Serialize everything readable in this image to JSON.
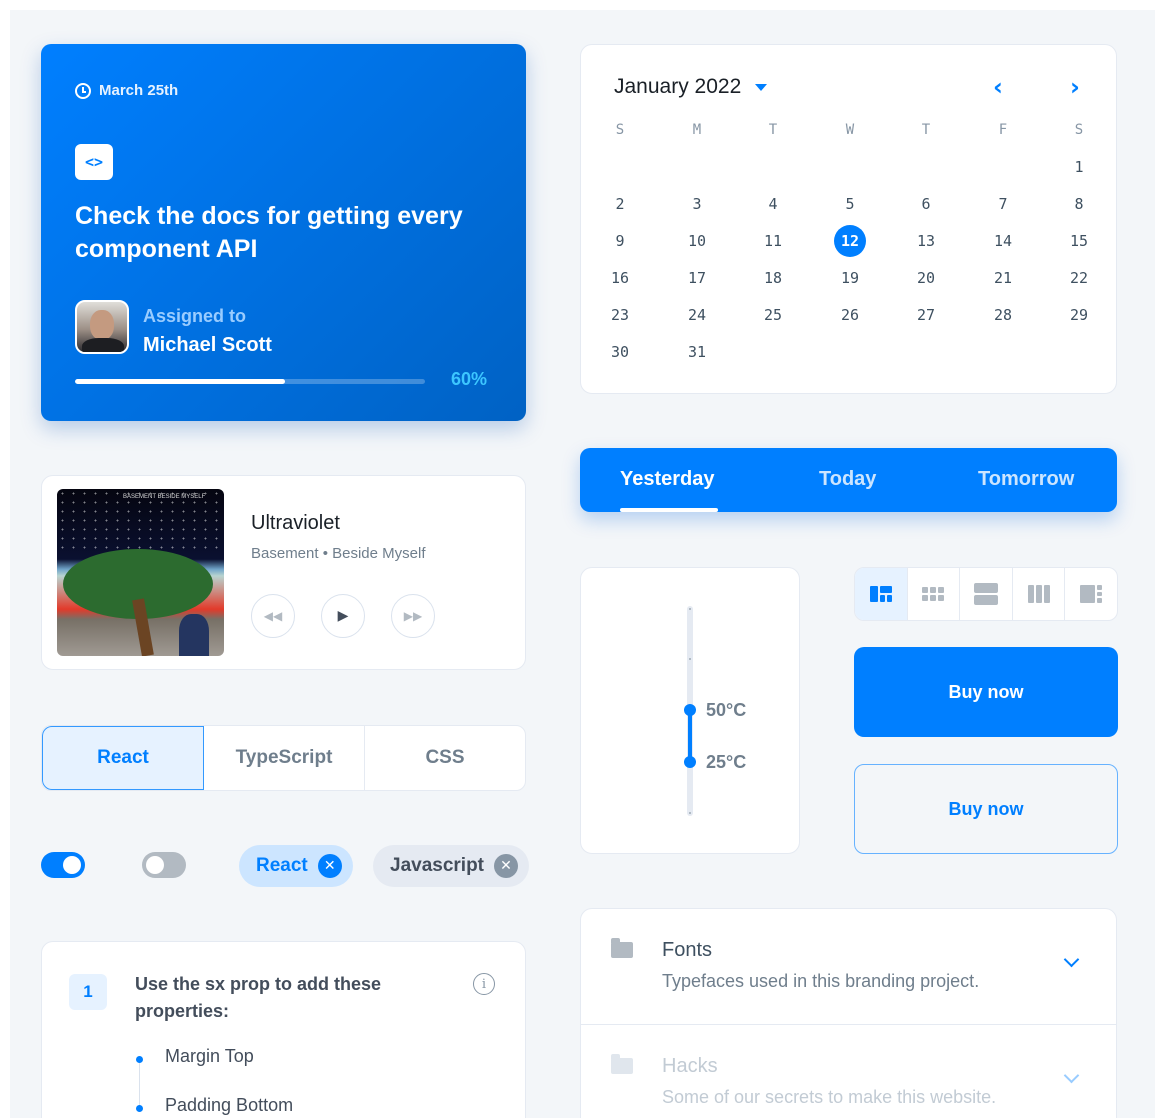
{
  "task_card": {
    "date": "March 25th",
    "code_icon": "code-icon",
    "title": "Check the docs for getting every component API",
    "assigned_label": "Assigned to",
    "assignee": "Michael Scott",
    "progress": 0.6,
    "progress_label": "60%"
  },
  "calendar": {
    "month_label": "January 2022",
    "weekdays": [
      "S",
      "M",
      "T",
      "W",
      "T",
      "F",
      "S"
    ],
    "first_weekday_index": 6,
    "days_in_month": 31,
    "selected_day": 12,
    "prev_icon": "chevron-left-icon",
    "next_icon": "chevron-right-icon"
  },
  "day_tabs": {
    "items": [
      "Yesterday",
      "Today",
      "Tomorrow"
    ],
    "active": 0
  },
  "player": {
    "album_art_text": "BASEMENT BESIDE MYSELF",
    "song": "Ultraviolet",
    "artist_line": "Basement • Beside Myself",
    "controls": [
      "rewind-icon",
      "play-icon",
      "fast-forward-icon"
    ]
  },
  "temp_slider": {
    "high_label": "50°C",
    "low_label": "25°C"
  },
  "view_toggle": {
    "icons": [
      "view-quilt-icon",
      "view-module-icon",
      "view-agenda-icon",
      "view-week-icon",
      "view-sidebar-icon"
    ],
    "selected": 0
  },
  "buttons": {
    "buy_primary": "Buy now",
    "buy_outlined": "Buy now"
  },
  "segmented": {
    "items": [
      "React",
      "TypeScript",
      "CSS"
    ],
    "active": 0
  },
  "switches": [
    {
      "checked": true
    },
    {
      "checked": false
    }
  ],
  "chips": [
    {
      "label": "React",
      "variant": "primary"
    },
    {
      "label": "Javascript",
      "variant": "neutral"
    }
  ],
  "steps": {
    "number": "1",
    "text": "Use the sx prop to add these properties:",
    "items": [
      "Margin Top",
      "Padding Bottom"
    ]
  },
  "accordion": [
    {
      "title": "Fonts",
      "description": "Typefaces used in this branding project."
    },
    {
      "title": "Hacks",
      "description": "Some of our secrets to make this website."
    }
  ],
  "colors": {
    "primary": "#007fff",
    "primary_dark": "#0059b2",
    "background": "#f3f6f9",
    "border": "#e5eaf2",
    "text": "#3e5060",
    "muted": "#6f7e8c"
  }
}
